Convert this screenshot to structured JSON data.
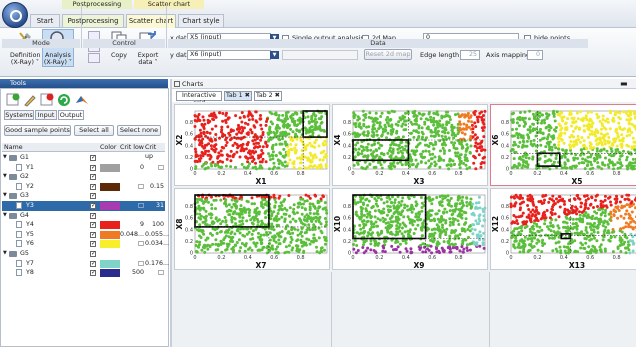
{
  "ribbon_tabs": {
    "context_groups": [
      "Postprocessing",
      "Scatter chart"
    ],
    "tabs": [
      "Start",
      "Postprocessing",
      "Scatter chart",
      "Chart style"
    ],
    "active": "Scatter chart"
  },
  "ribbon": {
    "mode": {
      "label": "Mode",
      "definition": "Definition",
      "definition_sub": "(X-Ray) ˅",
      "analysis": "Analysis",
      "analysis_sub": "(X-Ray) ˅"
    },
    "control": {
      "label": "Control",
      "copy": "Copy",
      "copy_sub": "˅",
      "export": "Export",
      "export_sub": "data ˅"
    },
    "data": {
      "label": "Data",
      "xdata_label": "x data",
      "xdata_value": "X5 (input)",
      "ydata_label": "y data",
      "ydata_value": "X6 (input)",
      "single_output": "Single output analysis",
      "map2d": "2d Map",
      "reset2d": "Reset 2d map",
      "map_field_value": "0",
      "hide_points": "hide points",
      "edge_length_label": "Edge length",
      "edge_length_value": "25",
      "axis_mapping_label": "Axis mapping",
      "axis_mapping_value": "0"
    }
  },
  "tools": {
    "title": "Tools",
    "tabs": [
      "Systems",
      "Input",
      "Output"
    ],
    "active_tab": "Output",
    "buttons": [
      "Good sample points",
      "Select all",
      "Select none"
    ],
    "columns": [
      "Name",
      "Color",
      "Crit low",
      "Crit up"
    ],
    "rows": [
      {
        "name": "G1",
        "type": "group",
        "color": "",
        "low": "",
        "up": ""
      },
      {
        "name": "Y1",
        "type": "item",
        "color": "#a0a0a0",
        "low": "0",
        "up": "□"
      },
      {
        "name": "G2",
        "type": "group",
        "color": "",
        "low": "",
        "up": ""
      },
      {
        "name": "Y2",
        "type": "item",
        "color": "#5c2a06",
        "low": "□",
        "up": "0.15"
      },
      {
        "name": "G3",
        "type": "group",
        "color": "",
        "low": "",
        "up": ""
      },
      {
        "name": "Y3",
        "type": "item",
        "color": "#a83bb0",
        "low": "□",
        "up": "31",
        "selected": true
      },
      {
        "name": "G4",
        "type": "group",
        "color": "",
        "low": "",
        "up": ""
      },
      {
        "name": "Y4",
        "type": "item",
        "color": "#e8211d",
        "low": "9",
        "up": "100"
      },
      {
        "name": "Y5",
        "type": "item",
        "color": "#f07a22",
        "low": "0.048...",
        "up": "0.055..."
      },
      {
        "name": "Y6",
        "type": "item",
        "color": "#f7ef2b",
        "low": "□",
        "up": "0.034..."
      },
      {
        "name": "G5",
        "type": "group",
        "color": "",
        "low": "",
        "up": ""
      },
      {
        "name": "Y7",
        "type": "item",
        "color": "#7fd3c8",
        "low": "□",
        "up": "0.176..."
      },
      {
        "name": "Y8",
        "type": "item",
        "color": "#2a2a8e",
        "low": "500",
        "up": "□"
      }
    ]
  },
  "charts": {
    "title": "Charts",
    "tabs": [
      "Interactive grid",
      "Tab 1 ✖",
      "Tab 2 ✖"
    ],
    "active_tab": "Tab 1 ✖",
    "colors": {
      "green": "#5bbf3b",
      "red": "#e8211d",
      "yellow": "#f2ea2a",
      "orange": "#f07a22",
      "purple": "#9b33a3",
      "cyan": "#7fd3c8"
    },
    "plots": [
      {
        "xlabel": "X1",
        "ylabel": "X2",
        "xticks": [
          "0",
          "0.2",
          "0.4",
          "0.6",
          "0.8"
        ],
        "yticks": [
          "0",
          "0.2",
          "0.4",
          "0.6",
          "0.8"
        ]
      },
      {
        "xlabel": "X3",
        "ylabel": "X4",
        "xticks": [
          "0",
          "0.2",
          "0.4",
          "0.6",
          "0.8"
        ],
        "yticks": [
          "0",
          "0.2",
          "0.4",
          "0.6",
          "0.8"
        ]
      },
      {
        "xlabel": "X5",
        "ylabel": "X6",
        "xticks": [
          "0",
          "0.2",
          "0.4",
          "0.6",
          "0.8"
        ],
        "yticks": [
          "0",
          "0.2",
          "0.4",
          "0.6",
          "0.8"
        ]
      },
      {
        "xlabel": "X7",
        "ylabel": "X8",
        "xticks": [
          "0",
          "0.2",
          "0.4",
          "0.6",
          "0.8"
        ],
        "yticks": [
          "0",
          "0.2",
          "0.4",
          "0.6",
          "0.8"
        ]
      },
      {
        "xlabel": "X9",
        "ylabel": "X10",
        "xticks": [
          "0",
          "0.2",
          "0.4",
          "0.6",
          "0.8"
        ],
        "yticks": [
          "0",
          "0.2",
          "0.4",
          "0.6",
          "0.8"
        ]
      },
      {
        "xlabel": "X13",
        "ylabel": "X12",
        "xticks": [
          "0",
          "0.2",
          "0.4",
          "0.6",
          "0.8"
        ],
        "yticks": [
          "0",
          "0.2",
          "0.4",
          "0.6",
          "0.8"
        ]
      }
    ]
  }
}
